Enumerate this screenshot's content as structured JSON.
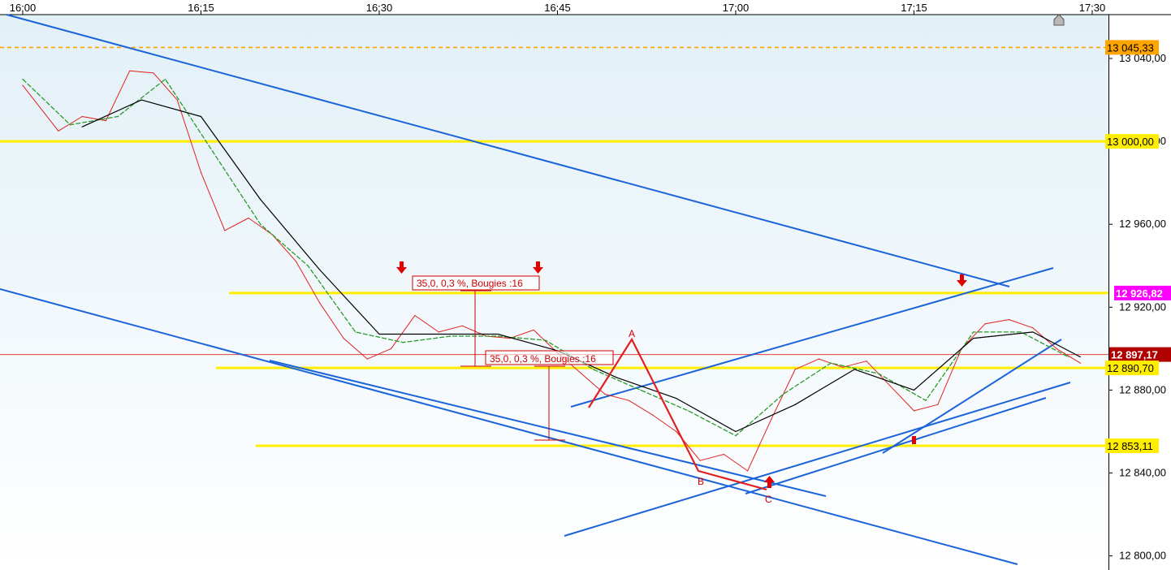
{
  "chart_data": {
    "type": "line",
    "title": "",
    "xlabel": "",
    "ylabel": "",
    "x_ticks": [
      "16:00",
      "16:15",
      "16:30",
      "16:45",
      "17:00",
      "17:15",
      "17:30"
    ],
    "y_ticks": [
      "13 040,00",
      "13 000,00",
      "12 960,00",
      "12 920,00",
      "12 880,00",
      "12 840,00",
      "12 800,00"
    ],
    "y_tick_values": [
      13040,
      13000,
      12960,
      12920,
      12880,
      12840,
      12800
    ],
    "x_range": [
      "16:00",
      "17:30"
    ],
    "ylim": [
      12793,
      13060
    ],
    "grid": false,
    "series": [
      {
        "color": "#e02020",
        "x": [
          "16:00",
          "16:03",
          "16:05",
          "16:07",
          "16:09",
          "16:11",
          "16:13",
          "16:15",
          "16:17",
          "16:19",
          "16:21",
          "16:23",
          "16:25",
          "16:27",
          "16:29",
          "16:31",
          "16:33",
          "16:35",
          "16:37",
          "16:39",
          "16:41",
          "16:43",
          "16:45",
          "16:47",
          "16:49",
          "16:51",
          "16:53",
          "16:55",
          "16:57",
          "16:59",
          "17:01",
          "17:03",
          "17:05",
          "17:07",
          "17:09",
          "17:11",
          "17:13",
          "17:15",
          "17:17",
          "17:19",
          "17:21",
          "17:23",
          "17:25",
          "17:27",
          "17:29"
        ],
        "values": [
          13027,
          13005,
          13012,
          13010,
          13034,
          13033,
          13020,
          12985,
          12957,
          12963,
          12955,
          12942,
          12922,
          12905,
          12895,
          12900,
          12916,
          12908,
          12911,
          12906,
          12905,
          12909,
          12898,
          12888,
          12878,
          12875,
          12868,
          12860,
          12846,
          12849,
          12841,
          12866,
          12890,
          12895,
          12891,
          12894,
          12882,
          12870,
          12873,
          12900,
          12912,
          12914,
          12910,
          12900,
          12893
        ]
      },
      {
        "color": "#2a9a2a",
        "x": [
          "16:00",
          "16:04",
          "16:08",
          "16:12",
          "16:16",
          "16:20",
          "16:24",
          "16:28",
          "16:32",
          "16:36",
          "16:40",
          "16:44",
          "16:48",
          "16:52",
          "16:56",
          "17:00",
          "17:04",
          "17:08",
          "17:12",
          "17:16",
          "17:20",
          "17:24",
          "17:28"
        ],
        "values": [
          13030,
          13008,
          13012,
          13030,
          12995,
          12960,
          12940,
          12908,
          12903,
          12906,
          12906,
          12904,
          12890,
          12880,
          12870,
          12858,
          12878,
          12893,
          12888,
          12875,
          12908,
          12908,
          12896
        ]
      },
      {
        "color": "#000000",
        "x": [
          "16:05",
          "16:10",
          "16:15",
          "16:20",
          "16:25",
          "16:30",
          "16:35",
          "16:40",
          "16:45",
          "16:50",
          "16:55",
          "17:00",
          "17:05",
          "17:10",
          "17:15",
          "17:20",
          "17:25",
          "17:29"
        ],
        "values": [
          13007,
          13020,
          13012,
          12972,
          12938,
          12907,
          12907,
          12907,
          12899,
          12886,
          12876,
          12860,
          12873,
          12890,
          12880,
          12905,
          12908,
          12896
        ]
      }
    ],
    "horizontal_levels": [
      {
        "label": "13 045,33",
        "value": 13045.33,
        "color": "#ffa500",
        "dashed": true
      },
      {
        "label": "13 000,00",
        "value": 13000.0,
        "color": "#ffee00",
        "dashed": false
      },
      {
        "label": "12 926,82",
        "value": 12926.82,
        "color": "#ff00ff",
        "dashed": false
      },
      {
        "label": "12 897,17",
        "value": 12897.17,
        "color": "#c00000",
        "dashed": false
      },
      {
        "label": "12 890,70",
        "value": 12890.7,
        "color": "#ffee00",
        "dashed": false
      },
      {
        "label": "12 853,11",
        "value": 12853.11,
        "color": "#ffee00",
        "dashed": false
      }
    ],
    "annotations": [
      {
        "text": "35,0, 0,3 %, Bougies :16"
      },
      {
        "text": "35,0, 0,3 %, Bougies :16"
      },
      {
        "text": "A"
      },
      {
        "text": "B"
      },
      {
        "text": "C"
      }
    ]
  },
  "colors": {
    "background_top": "#e4f2f8",
    "background_bottom": "#ffffff",
    "trendline": "#1a63d8",
    "level_yellow": "#ffee00",
    "level_orange": "#ffa500",
    "current_price": "#b00000",
    "annotation": "#d00000"
  }
}
